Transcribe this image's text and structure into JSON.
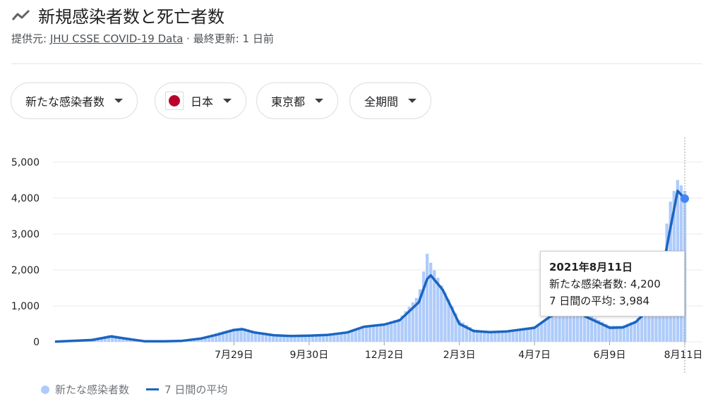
{
  "header": {
    "title": "新規感染者数と死亡者数",
    "source_prefix": "提供元:",
    "source_link": "JHU CSSE COVID-19 Data",
    "separator": " · ",
    "updated": "最終更新: 1 日前"
  },
  "filters": {
    "metric": "新たな感染者数",
    "country": "日本",
    "region": "東京都",
    "period": "全期間"
  },
  "tooltip": {
    "date": "2021年8月11日",
    "cases_line": "新たな感染者数: 4,200",
    "avg_line": "7 日間の平均: 3,984"
  },
  "legend": {
    "cases": "新たな感染者数",
    "avg": "7 日間の平均"
  },
  "colors": {
    "bars": "#aecbfa",
    "line": "#1a65c0",
    "marker": "#4285f4",
    "grid": "#e8eaed"
  },
  "chart_data": {
    "type": "bar",
    "title": "",
    "xlabel": "",
    "ylabel": "",
    "ylim": [
      0,
      5000
    ],
    "yticks": [
      "0",
      "1,000",
      "2,000",
      "3,000",
      "4,000",
      "5,000"
    ],
    "xticks": [
      "7月29日",
      "9月30日",
      "12月2日",
      "2月3日",
      "4月7日",
      "6月9日",
      "8月11日"
    ],
    "grid": true,
    "legend_position": "bottom-left",
    "series": [
      {
        "name": "新たな感染者数",
        "type": "bar",
        "note": "daily values, approximated (weekly resolution) from 2020-03-01 to 2021-08-11",
        "dates": [
          "2020-03-01",
          "2020-04-01",
          "2020-04-17",
          "2020-05-01",
          "2020-05-15",
          "2020-06-01",
          "2020-06-15",
          "2020-07-01",
          "2020-07-15",
          "2020-07-29",
          "2020-08-05",
          "2020-08-15",
          "2020-09-01",
          "2020-09-15",
          "2020-09-30",
          "2020-10-15",
          "2020-11-01",
          "2020-11-15",
          "2020-12-02",
          "2020-12-15",
          "2020-12-31",
          "2021-01-07",
          "2021-01-10",
          "2021-01-20",
          "2021-02-03",
          "2021-02-15",
          "2021-03-01",
          "2021-03-15",
          "2021-04-07",
          "2021-04-20",
          "2021-05-01",
          "2021-05-10",
          "2021-05-20",
          "2021-06-09",
          "2021-06-20",
          "2021-07-01",
          "2021-07-10",
          "2021-07-20",
          "2021-07-29",
          "2021-08-05",
          "2021-08-11"
        ],
        "values": [
          5,
          60,
          200,
          100,
          20,
          20,
          30,
          100,
          250,
          370,
          400,
          300,
          200,
          170,
          200,
          200,
          280,
          450,
          500,
          650,
          1300,
          2450,
          2200,
          1500,
          600,
          350,
          280,
          300,
          430,
          700,
          900,
          1000,
          800,
          450,
          450,
          600,
          900,
          1500,
          3800,
          4500,
          4200
        ]
      },
      {
        "name": "7 日間の平均",
        "type": "line",
        "dates": [
          "2020-03-01",
          "2020-04-01",
          "2020-04-17",
          "2020-05-01",
          "2020-05-15",
          "2020-06-01",
          "2020-06-15",
          "2020-07-01",
          "2020-07-15",
          "2020-07-29",
          "2020-08-05",
          "2020-08-15",
          "2020-09-01",
          "2020-09-15",
          "2020-09-30",
          "2020-10-15",
          "2020-11-01",
          "2020-11-15",
          "2020-12-02",
          "2020-12-15",
          "2020-12-31",
          "2021-01-07",
          "2021-01-10",
          "2021-01-20",
          "2021-02-03",
          "2021-02-15",
          "2021-03-01",
          "2021-03-15",
          "2021-04-07",
          "2021-04-20",
          "2021-05-01",
          "2021-05-10",
          "2021-05-20",
          "2021-06-09",
          "2021-06-20",
          "2021-07-01",
          "2021-07-10",
          "2021-07-20",
          "2021-07-29",
          "2021-08-05",
          "2021-08-11"
        ],
        "values": [
          3,
          50,
          150,
          80,
          15,
          15,
          25,
          90,
          200,
          330,
          350,
          260,
          180,
          160,
          170,
          190,
          260,
          420,
          480,
          600,
          1100,
          1750,
          1850,
          1450,
          500,
          300,
          270,
          290,
          390,
          700,
          850,
          900,
          700,
          390,
          400,
          550,
          850,
          1400,
          3000,
          4200,
          3984
        ]
      }
    ]
  }
}
